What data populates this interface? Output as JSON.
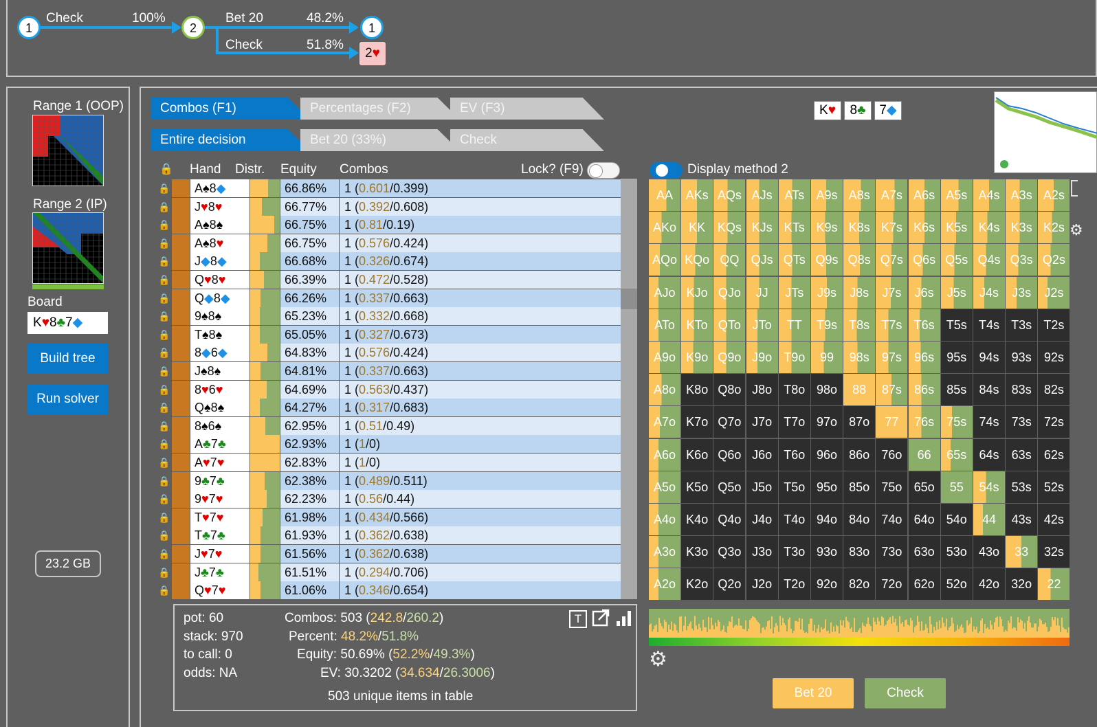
{
  "tree": {
    "node1_label": "1",
    "node2_label": "2",
    "node3_label": "1",
    "terminal_label": "2",
    "action_check": "Check",
    "action_check_pct": "100%",
    "action_bet": "Bet 20",
    "action_bet_pct": "48.2%",
    "action_check2": "Check",
    "action_check2_pct": "51.8%"
  },
  "left": {
    "range1_label": "Range 1 (OOP)",
    "range2_label": "Range 2 (IP)",
    "board_label": "Board",
    "build_tree": "Build tree",
    "run_solver": "Run solver",
    "memory": "23.2 GB"
  },
  "tabs_top": [
    "Combos (F1)",
    "Percentages (F2)",
    "EV (F3)"
  ],
  "tabs_bottom": [
    "Entire decision",
    "Bet 20 (33%)",
    "Check"
  ],
  "board_cards": [
    {
      "rank": "K",
      "suit": "♥",
      "color": "red"
    },
    {
      "rank": "8",
      "suit": "♣",
      "color": "grn"
    },
    {
      "rank": "7",
      "suit": "◆",
      "color": "blu"
    }
  ],
  "table": {
    "headers": {
      "hand": "Hand",
      "distr": "Distr.",
      "equity": "Equity",
      "combos": "Combos",
      "lock": "Lock? (F9)"
    },
    "rows": [
      {
        "c1": "A",
        "s1": "♠",
        "k1": "blk",
        "c2": "8",
        "s2": "◆",
        "k2": "blu",
        "bet": 0.6,
        "equity": "66.86%",
        "n": "1",
        "a": "0.601",
        "b": "0.399"
      },
      {
        "c1": "J",
        "s1": "♥",
        "k1": "red",
        "c2": "8",
        "s2": "♥",
        "k2": "red",
        "bet": 0.39,
        "equity": "66.77%",
        "n": "1",
        "a": "0.392",
        "b": "0.608"
      },
      {
        "c1": "A",
        "s1": "♠",
        "k1": "blk",
        "c2": "8",
        "s2": "♠",
        "k2": "blk",
        "bet": 0.81,
        "equity": "66.75%",
        "n": "1",
        "a": "0.81",
        "b": "0.19"
      },
      {
        "c1": "A",
        "s1": "♠",
        "k1": "blk",
        "c2": "8",
        "s2": "♥",
        "k2": "red",
        "bet": 0.58,
        "equity": "66.75%",
        "n": "1",
        "a": "0.576",
        "b": "0.424"
      },
      {
        "c1": "J",
        "s1": "◆",
        "k1": "blu",
        "c2": "8",
        "s2": "◆",
        "k2": "blu",
        "bet": 0.33,
        "equity": "66.68%",
        "n": "1",
        "a": "0.326",
        "b": "0.674"
      },
      {
        "c1": "Q",
        "s1": "♥",
        "k1": "red",
        "c2": "8",
        "s2": "♥",
        "k2": "red",
        "bet": 0.47,
        "equity": "66.39%",
        "n": "1",
        "a": "0.472",
        "b": "0.528"
      },
      {
        "c1": "Q",
        "s1": "◆",
        "k1": "blu",
        "c2": "8",
        "s2": "◆",
        "k2": "blu",
        "bet": 0.34,
        "equity": "66.26%",
        "n": "1",
        "a": "0.337",
        "b": "0.663"
      },
      {
        "c1": "9",
        "s1": "♠",
        "k1": "blk",
        "c2": "8",
        "s2": "♠",
        "k2": "blk",
        "bet": 0.33,
        "equity": "65.23%",
        "n": "1",
        "a": "0.332",
        "b": "0.668"
      },
      {
        "c1": "T",
        "s1": "♠",
        "k1": "blk",
        "c2": "8",
        "s2": "♠",
        "k2": "blk",
        "bet": 0.33,
        "equity": "65.05%",
        "n": "1",
        "a": "0.327",
        "b": "0.673"
      },
      {
        "c1": "8",
        "s1": "◆",
        "k1": "blu",
        "c2": "6",
        "s2": "◆",
        "k2": "blu",
        "bet": 0.58,
        "equity": "64.83%",
        "n": "1",
        "a": "0.576",
        "b": "0.424"
      },
      {
        "c1": "J",
        "s1": "♠",
        "k1": "blk",
        "c2": "8",
        "s2": "♠",
        "k2": "blk",
        "bet": 0.34,
        "equity": "64.81%",
        "n": "1",
        "a": "0.337",
        "b": "0.663"
      },
      {
        "c1": "8",
        "s1": "♥",
        "k1": "red",
        "c2": "6",
        "s2": "♥",
        "k2": "red",
        "bet": 0.56,
        "equity": "64.69%",
        "n": "1",
        "a": "0.563",
        "b": "0.437"
      },
      {
        "c1": "Q",
        "s1": "♠",
        "k1": "blk",
        "c2": "8",
        "s2": "♠",
        "k2": "blk",
        "bet": 0.32,
        "equity": "64.27%",
        "n": "1",
        "a": "0.317",
        "b": "0.683"
      },
      {
        "c1": "8",
        "s1": "♠",
        "k1": "blk",
        "c2": "6",
        "s2": "♠",
        "k2": "blk",
        "bet": 0.51,
        "equity": "62.95%",
        "n": "1",
        "a": "0.51",
        "b": "0.49"
      },
      {
        "c1": "A",
        "s1": "♣",
        "k1": "grn",
        "c2": "7",
        "s2": "♣",
        "k2": "grn",
        "bet": 1.0,
        "equity": "62.93%",
        "n": "1",
        "a": "1",
        "b": "0"
      },
      {
        "c1": "A",
        "s1": "♥",
        "k1": "red",
        "c2": "7",
        "s2": "♥",
        "k2": "red",
        "bet": 1.0,
        "equity": "62.83%",
        "n": "1",
        "a": "1",
        "b": "0"
      },
      {
        "c1": "9",
        "s1": "♣",
        "k1": "grn",
        "c2": "7",
        "s2": "♣",
        "k2": "grn",
        "bet": 0.49,
        "equity": "62.38%",
        "n": "1",
        "a": "0.489",
        "b": "0.511"
      },
      {
        "c1": "9",
        "s1": "♥",
        "k1": "red",
        "c2": "7",
        "s2": "♥",
        "k2": "red",
        "bet": 0.56,
        "equity": "62.23%",
        "n": "1",
        "a": "0.56",
        "b": "0.44"
      },
      {
        "c1": "T",
        "s1": "♥",
        "k1": "red",
        "c2": "7",
        "s2": "♥",
        "k2": "red",
        "bet": 0.43,
        "equity": "61.98%",
        "n": "1",
        "a": "0.434",
        "b": "0.566"
      },
      {
        "c1": "T",
        "s1": "♣",
        "k1": "grn",
        "c2": "7",
        "s2": "♣",
        "k2": "grn",
        "bet": 0.36,
        "equity": "61.93%",
        "n": "1",
        "a": "0.362",
        "b": "0.638"
      },
      {
        "c1": "J",
        "s1": "♥",
        "k1": "red",
        "c2": "7",
        "s2": "♥",
        "k2": "red",
        "bet": 0.36,
        "equity": "61.56%",
        "n": "1",
        "a": "0.362",
        "b": "0.638"
      },
      {
        "c1": "J",
        "s1": "♣",
        "k1": "grn",
        "c2": "7",
        "s2": "♣",
        "k2": "grn",
        "bet": 0.29,
        "equity": "61.51%",
        "n": "1",
        "a": "0.294",
        "b": "0.706"
      },
      {
        "c1": "Q",
        "s1": "♥",
        "k1": "red",
        "c2": "7",
        "s2": "♥",
        "k2": "red",
        "bet": 0.35,
        "equity": "61.06%",
        "n": "1",
        "a": "0.346",
        "b": "0.654"
      }
    ]
  },
  "info": {
    "pot": "pot: 60",
    "stack": "stack: 970",
    "to_call": "to call: 0",
    "odds": "odds: NA",
    "combos_label": "Combos:",
    "combos_total": "503 (",
    "combos_a": "242.8",
    "combos_b": "260.2",
    "percent_label": "Percent:",
    "percent_a": "48.2%",
    "percent_b": "51.8%",
    "equity_label": "Equity:",
    "equity_total": "50.69% (",
    "equity_a": "52.2%",
    "equity_b": "49.3%",
    "ev_label": "EV:",
    "ev_total": "30.3202 (",
    "ev_a": "34.634",
    "ev_b": "26.3006",
    "unique": "503 unique items in table",
    "icon_t": "T"
  },
  "display_method": "Display method 2",
  "grid": {
    "labels": [
      [
        "AA",
        "AKs",
        "AQs",
        "AJs",
        "ATs",
        "A9s",
        "A8s",
        "A7s",
        "A6s",
        "A5s",
        "A4s",
        "A3s",
        "A2s"
      ],
      [
        "AKo",
        "KK",
        "KQs",
        "KJs",
        "KTs",
        "K9s",
        "K8s",
        "K7s",
        "K6s",
        "K5s",
        "K4s",
        "K3s",
        "K2s"
      ],
      [
        "AQo",
        "KQo",
        "QQ",
        "QJs",
        "QTs",
        "Q9s",
        "Q8s",
        "Q7s",
        "Q6s",
        "Q5s",
        "Q4s",
        "Q3s",
        "Q2s"
      ],
      [
        "AJo",
        "KJo",
        "QJo",
        "JJ",
        "JTs",
        "J9s",
        "J8s",
        "J7s",
        "J6s",
        "J5s",
        "J4s",
        "J3s",
        "J2s"
      ],
      [
        "ATo",
        "KTo",
        "QTo",
        "JTo",
        "TT",
        "T9s",
        "T8s",
        "T7s",
        "T6s",
        "T5s",
        "T4s",
        "T3s",
        "T2s"
      ],
      [
        "A9o",
        "K9o",
        "Q9o",
        "J9o",
        "T9o",
        "99",
        "98s",
        "97s",
        "96s",
        "95s",
        "94s",
        "93s",
        "92s"
      ],
      [
        "A8o",
        "K8o",
        "Q8o",
        "J8o",
        "T8o",
        "98o",
        "88",
        "87s",
        "86s",
        "85s",
        "84s",
        "83s",
        "82s"
      ],
      [
        "A7o",
        "K7o",
        "Q7o",
        "J7o",
        "T7o",
        "97o",
        "87o",
        "77",
        "76s",
        "75s",
        "74s",
        "73s",
        "72s"
      ],
      [
        "A6o",
        "K6o",
        "Q6o",
        "J6o",
        "T6o",
        "96o",
        "86o",
        "76o",
        "66",
        "65s",
        "64s",
        "63s",
        "62s"
      ],
      [
        "A5o",
        "K5o",
        "Q5o",
        "J5o",
        "T5o",
        "95o",
        "85o",
        "75o",
        "65o",
        "55",
        "54s",
        "53s",
        "52s"
      ],
      [
        "A4o",
        "K4o",
        "Q4o",
        "J4o",
        "T4o",
        "94o",
        "84o",
        "74o",
        "64o",
        "54o",
        "44",
        "43s",
        "42s"
      ],
      [
        "A3o",
        "K3o",
        "Q3o",
        "J3o",
        "T3o",
        "93o",
        "83o",
        "73o",
        "63o",
        "53o",
        "43o",
        "33",
        "32s"
      ],
      [
        "A2o",
        "K2o",
        "Q2o",
        "J2o",
        "T2o",
        "92o",
        "82o",
        "72o",
        "62o",
        "52o",
        "42o",
        "32o",
        "22"
      ]
    ],
    "bet_frequency": [
      [
        0.55,
        0.5,
        0.45,
        0.4,
        0.42,
        0.48,
        0.55,
        0.6,
        0.5,
        0.55,
        0.5,
        0.45,
        0.5
      ],
      [
        0.4,
        0.5,
        0.45,
        0.4,
        0.4,
        0.45,
        0.5,
        0.55,
        0.5,
        0.48,
        0.45,
        0.45,
        0.45
      ],
      [
        0.35,
        0.45,
        0.4,
        0.4,
        0.42,
        0.48,
        0.52,
        0.5,
        0.45,
        0.42,
        0.4,
        0.4,
        0.4
      ],
      [
        0.3,
        0.4,
        0.4,
        0.4,
        0.4,
        0.5,
        0.45,
        0.48,
        0.4,
        0.4,
        0.35,
        0.35,
        0.3
      ],
      [
        0.3,
        0.4,
        0.4,
        0.35,
        0.4,
        0.45,
        0.42,
        0.4,
        0.35,
        null,
        null,
        null,
        null
      ],
      [
        0.35,
        0.38,
        0.4,
        0.35,
        0.4,
        0.4,
        0.45,
        0.4,
        0.38,
        null,
        null,
        null,
        null
      ],
      [
        0.4,
        null,
        null,
        null,
        null,
        null,
        1.0,
        0.5,
        0.4,
        null,
        null,
        null,
        null
      ],
      [
        0.35,
        null,
        null,
        null,
        null,
        null,
        null,
        1.0,
        0.4,
        0.35,
        null,
        null,
        null
      ],
      [
        0.3,
        null,
        null,
        null,
        null,
        null,
        null,
        null,
        0.0,
        0.3,
        null,
        null,
        null
      ],
      [
        0.3,
        null,
        null,
        null,
        null,
        null,
        null,
        null,
        null,
        0.0,
        0.4,
        null,
        null
      ],
      [
        0.3,
        null,
        null,
        null,
        null,
        null,
        null,
        null,
        null,
        null,
        0.3,
        null,
        null
      ],
      [
        0.3,
        null,
        null,
        null,
        null,
        null,
        null,
        null,
        null,
        null,
        null,
        0.5,
        null
      ],
      [
        0.3,
        null,
        null,
        null,
        null,
        null,
        null,
        null,
        null,
        null,
        null,
        null,
        0.4
      ]
    ]
  },
  "actions": {
    "bet": "Bet 20",
    "check": "Check"
  },
  "colors": {
    "bet": "#fcc45c",
    "check": "#8aae6a",
    "accent": "#0a78c8",
    "tree_line": "#1ea0e6"
  }
}
